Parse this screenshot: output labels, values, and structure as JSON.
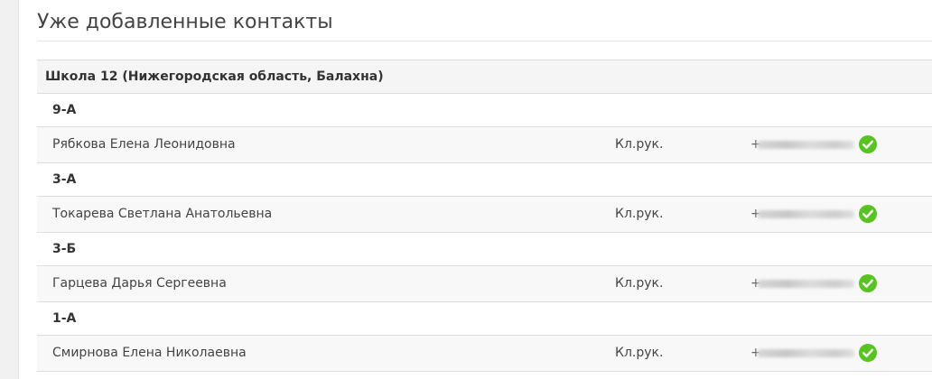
{
  "page_title": "Уже добавленные контакты",
  "colors": {
    "check_green": "#58c322",
    "row_alt_bg": "#f8f8f8",
    "school_bg": "#f5f5f5",
    "border": "#dddddd"
  },
  "school": {
    "label": "Школа 12 (Нижегородская область, Балахна)"
  },
  "groups": [
    {
      "class_label": "9-А",
      "contact": {
        "name": "Рябкова Елена Леонидовна",
        "role": "Кл.рук.",
        "phone_prefix": "+",
        "phone_obscured": true,
        "status_icon": "check-circle-icon"
      }
    },
    {
      "class_label": "3-А",
      "contact": {
        "name": "Токарева Светлана Анатольевна",
        "role": "Кл.рук.",
        "phone_prefix": "+",
        "phone_obscured": true,
        "status_icon": "check-circle-icon"
      }
    },
    {
      "class_label": "3-Б",
      "contact": {
        "name": "Гарцева Дарья Сергеевна",
        "role": "Кл.рук.",
        "phone_prefix": "+",
        "phone_obscured": true,
        "status_icon": "check-circle-icon"
      }
    },
    {
      "class_label": "1-А",
      "contact": {
        "name": "Смирнова Елена Николаевна",
        "role": "Кл.рук.",
        "phone_prefix": "+",
        "phone_obscured": true,
        "status_icon": "check-circle-icon"
      }
    }
  ]
}
